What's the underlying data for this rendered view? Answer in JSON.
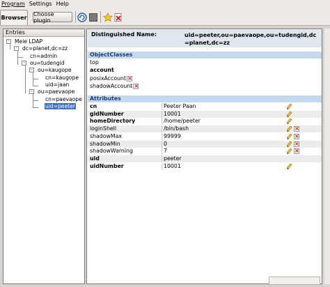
{
  "menu": [
    "Program",
    "Settings",
    "Help"
  ],
  "toolbar": {
    "tab_label": "Browser",
    "choose_plugin_label": "Choose plugin"
  },
  "tree": {
    "header": "Entries",
    "nodes": [
      {
        "label": "Meie LDAP",
        "expander": "-"
      },
      {
        "label": "dc=planet,dc=zz",
        "expander": "-"
      },
      {
        "label": "cn=admin",
        "expander": ""
      },
      {
        "label": "ou=tudengid",
        "expander": "-"
      },
      {
        "label": "ou=kaugope",
        "expander": "-"
      },
      {
        "label": "cn=kaugope",
        "expander": ""
      },
      {
        "label": "uid=jaan",
        "expander": ""
      },
      {
        "label": "ou=paevaope",
        "expander": "-"
      },
      {
        "label": "cn=paevaope",
        "expander": ""
      },
      {
        "label": "uid=peeter",
        "expander": ""
      }
    ]
  },
  "details": {
    "dn_label": "Distinguished Name:",
    "dn_value": "uid=peeter,ou=paevaope,ou=tudengid,dc=planet,dc=zz",
    "objectclasses_header": "ObjectClasses",
    "objectclasses": [
      {
        "name": "top",
        "bold": false,
        "deletable": false
      },
      {
        "name": "account",
        "bold": true,
        "deletable": false
      },
      {
        "name": "posixAccount",
        "bold": false,
        "deletable": true
      },
      {
        "name": "shadowAccount",
        "bold": false,
        "deletable": true
      }
    ],
    "attributes_header": "Attributes",
    "attributes": [
      {
        "name": "cn",
        "value": "Peeter Paan",
        "bold": true,
        "editable": true,
        "deletable": false
      },
      {
        "name": "gidNumber",
        "value": "10001",
        "bold": true,
        "editable": true,
        "deletable": false
      },
      {
        "name": "homeDirectory",
        "value": "/home/peeter",
        "bold": true,
        "editable": true,
        "deletable": false
      },
      {
        "name": "loginShell",
        "value": "/bin/bash",
        "bold": false,
        "editable": true,
        "deletable": true
      },
      {
        "name": "shadowMax",
        "value": "99999",
        "bold": false,
        "editable": true,
        "deletable": true
      },
      {
        "name": "shadowMin",
        "value": "0",
        "bold": false,
        "editable": true,
        "deletable": true
      },
      {
        "name": "shadowWarning",
        "value": "7",
        "bold": false,
        "editable": true,
        "deletable": true
      },
      {
        "name": "uid",
        "value": "peeter",
        "bold": true,
        "editable": false,
        "deletable": false
      },
      {
        "name": "uidNumber",
        "value": "10001",
        "bold": true,
        "editable": true,
        "deletable": false
      }
    ]
  },
  "colors": {
    "selection": "#3d71b8",
    "section_header": "#c5d8ee",
    "dn_header": "#dfe6ef",
    "delete_red": "#dd0000"
  }
}
